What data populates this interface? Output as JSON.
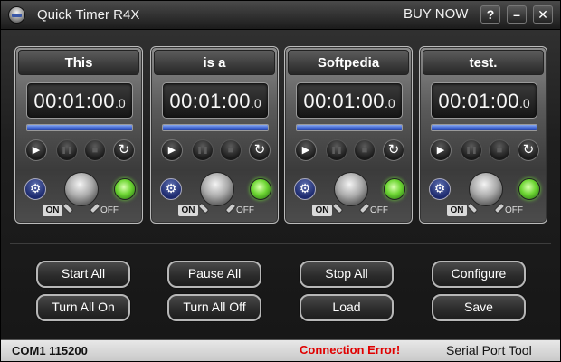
{
  "app": {
    "title": "Quick Timer R4X",
    "buy_now": "BUY NOW",
    "help_label": "?",
    "minimize_label": "–",
    "close_label": "✕"
  },
  "timers": [
    {
      "name": "This",
      "time": "00:01:00",
      "frac": ".0",
      "progress": 1.0,
      "on_label": "ON",
      "off_label": "OFF"
    },
    {
      "name": "is a",
      "time": "00:01:00",
      "frac": ".0",
      "progress": 1.0,
      "on_label": "ON",
      "off_label": "OFF"
    },
    {
      "name": "Softpedia",
      "time": "00:01:00",
      "frac": ".0",
      "progress": 1.0,
      "on_label": "ON",
      "off_label": "OFF"
    },
    {
      "name": "test.",
      "time": "00:01:00",
      "frac": ".0",
      "progress": 1.0,
      "on_label": "ON",
      "off_label": "OFF"
    }
  ],
  "controls": {
    "play_icon": "▶",
    "pause_icon": "❚❚",
    "stop_icon": "■",
    "reset_icon": "↻",
    "settings_icon": "⚙"
  },
  "actions": {
    "start_all": "Start All",
    "pause_all": "Pause All",
    "stop_all": "Stop All",
    "configure": "Configure",
    "turn_all_on": "Turn All On",
    "turn_all_off": "Turn All Off",
    "load": "Load",
    "save": "Save"
  },
  "status": {
    "port": "COM1 115200",
    "error": "Connection Error!",
    "tool": "Serial Port Tool"
  },
  "colors": {
    "progress_blue": "#3a5fcf",
    "lamp_green": "#6ed634",
    "error_red": "#e00000"
  }
}
